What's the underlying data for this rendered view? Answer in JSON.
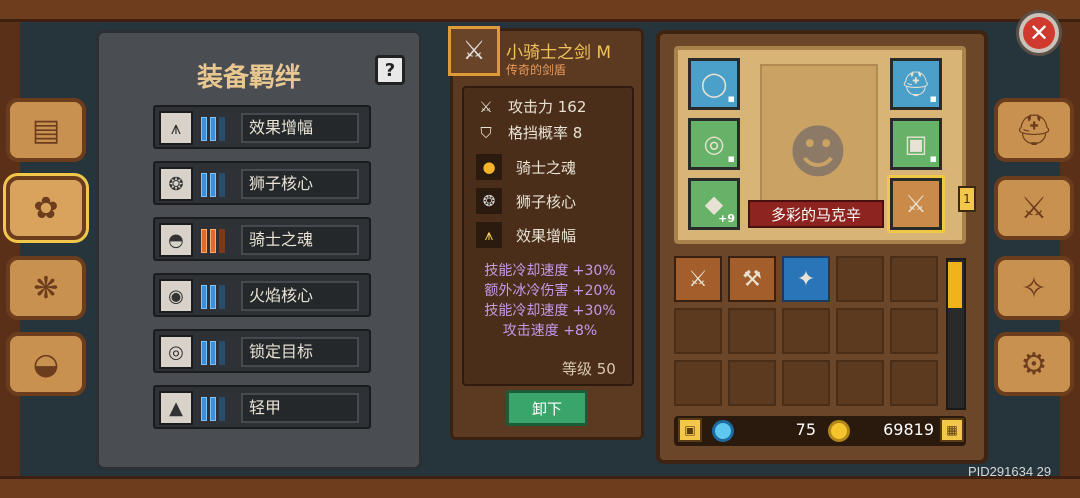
{
  "left_panel": {
    "title": "装备羁绊",
    "help_label": "?",
    "bonds": [
      {
        "name": "效果增幅",
        "icon": "rays-icon",
        "glyph": "⩚",
        "bar_color": "blue"
      },
      {
        "name": "狮子核心",
        "icon": "lion-icon",
        "glyph": "❂",
        "bar_color": "blue"
      },
      {
        "name": "骑士之魂",
        "icon": "soul-flame-icon",
        "glyph": "◓",
        "bar_color": "orange"
      },
      {
        "name": "火焰核心",
        "icon": "flame-icon",
        "glyph": "◉",
        "bar_color": "blue"
      },
      {
        "name": "锁定目标",
        "icon": "target-icon",
        "glyph": "◎",
        "bar_color": "blue"
      },
      {
        "name": "轻甲",
        "icon": "armor-icon",
        "glyph": "▲",
        "bar_color": "blue"
      }
    ]
  },
  "weapon": {
    "name": "小骑士之剑 M",
    "subtitle": "传奇的剑盾",
    "stats": [
      {
        "icon": "sword-icon",
        "glyph": "⚔",
        "label": "攻击力 162"
      },
      {
        "icon": "shield-icon",
        "glyph": "⛉",
        "label": "格挡概率 8"
      }
    ],
    "bonds": [
      {
        "icon": "soul-flame-icon",
        "glyph": "●",
        "color": "#f5b52a",
        "label": "骑士之魂"
      },
      {
        "icon": "lion-icon",
        "glyph": "❂",
        "color": "#cfcfcf",
        "label": "狮子核心"
      },
      {
        "icon": "rays-icon",
        "glyph": "⩚",
        "color": "#f5d25a",
        "label": "效果增幅"
      }
    ],
    "bonuses": [
      "技能冷却速度 +30%",
      "额外冰冷伤害 +20%",
      "技能冷却速度 +30%",
      "攻击速度 +8%"
    ],
    "level": "等级 50",
    "unequip_label": "卸下"
  },
  "equipment": {
    "banner": "多彩的马克辛",
    "left_slots": [
      {
        "icon": "collar-icon",
        "glyph": "◯",
        "color": "blue",
        "locked": true
      },
      {
        "icon": "ring-icon",
        "glyph": "◎",
        "color": "green",
        "locked": true
      },
      {
        "icon": "ore-icon",
        "glyph": "◆",
        "color": "green",
        "badge": "+9"
      }
    ],
    "right_slots": [
      {
        "icon": "helmet-icon",
        "glyph": "⛑",
        "color": "blue",
        "locked": true
      },
      {
        "icon": "chest-armor-icon",
        "glyph": "▣",
        "color": "green",
        "locked": true
      },
      {
        "icon": "sword-icon",
        "glyph": "⚔",
        "color": "sel"
      }
    ],
    "weapon_tag": "1"
  },
  "inventory": {
    "items": [
      {
        "icon": "spear-sword-icon",
        "glyph": "⚔"
      },
      {
        "icon": "crossbow-icon",
        "glyph": "⚒"
      },
      {
        "icon": "fox-pet-icon",
        "glyph": "✦"
      }
    ],
    "rows": 3,
    "cols": 5
  },
  "currency": {
    "gems": "75",
    "coins": "69819"
  },
  "side_tabs_left": [
    {
      "icon": "book-icon",
      "glyph": "▤"
    },
    {
      "icon": "bond-scroll-icon",
      "glyph": "✿",
      "active": true
    },
    {
      "icon": "gems-bag-icon",
      "glyph": "❋"
    },
    {
      "icon": "pet-icon",
      "glyph": "◒"
    }
  ],
  "side_tabs_right": [
    {
      "icon": "helmet-tab-icon",
      "glyph": "⛑"
    },
    {
      "icon": "upgrade-swords-icon",
      "glyph": "⚔"
    },
    {
      "icon": "compass-star-icon",
      "glyph": "✧"
    },
    {
      "icon": "gear-icon",
      "glyph": "⚙"
    }
  ],
  "close_label": "✕",
  "pid": "PID291634 29"
}
